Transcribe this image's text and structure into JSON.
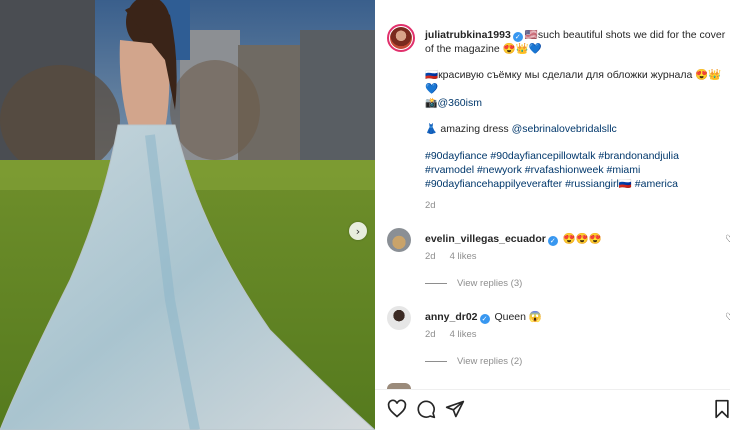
{
  "post": {
    "username": "juliatrubkina1993",
    "caption_line1": "🇺🇸such beautiful shots we did for the cover of the magazine 😍👑💙",
    "caption_ru": "🇷🇺красивую съёмку мы сделали для обложки журнала 😍👑💙",
    "photo_credit_icon": "📸",
    "photo_credit": "@360ism",
    "dress_icon": "👗",
    "dress_text": "amazing dress",
    "dress_link": "@sebrinalovebridalsllc",
    "hashtags": "#90dayfiance #90dayfiancepillowtalk #brandonandjulia #rvamodel #newyork #rvafashionweek #miami #90dayfiancehappilyeverafter #russiangirl🇷🇺 #america",
    "time": "2d"
  },
  "comments": [
    {
      "username": "evelin_villegas_ecuador",
      "text": "😍😍😍",
      "time": "2d",
      "likes": "4 likes",
      "replies": "View replies (3)",
      "heart_icon": "heart-outline-icon"
    },
    {
      "username": "anny_dr02",
      "text": "Queen 😱",
      "time": "2d",
      "likes": "4 likes",
      "replies": "View replies (2)",
      "heart_icon": "heart-outline-icon"
    }
  ],
  "actions": {
    "icons": [
      "heart-icon",
      "comment-icon",
      "share-icon",
      "bookmark-icon"
    ]
  },
  "carousel": {
    "next_icon": "›"
  },
  "colors": {
    "link": "#00376b",
    "verified": "#3897f0",
    "muted": "#8e8e8e",
    "story_ring": "#e1306c"
  }
}
